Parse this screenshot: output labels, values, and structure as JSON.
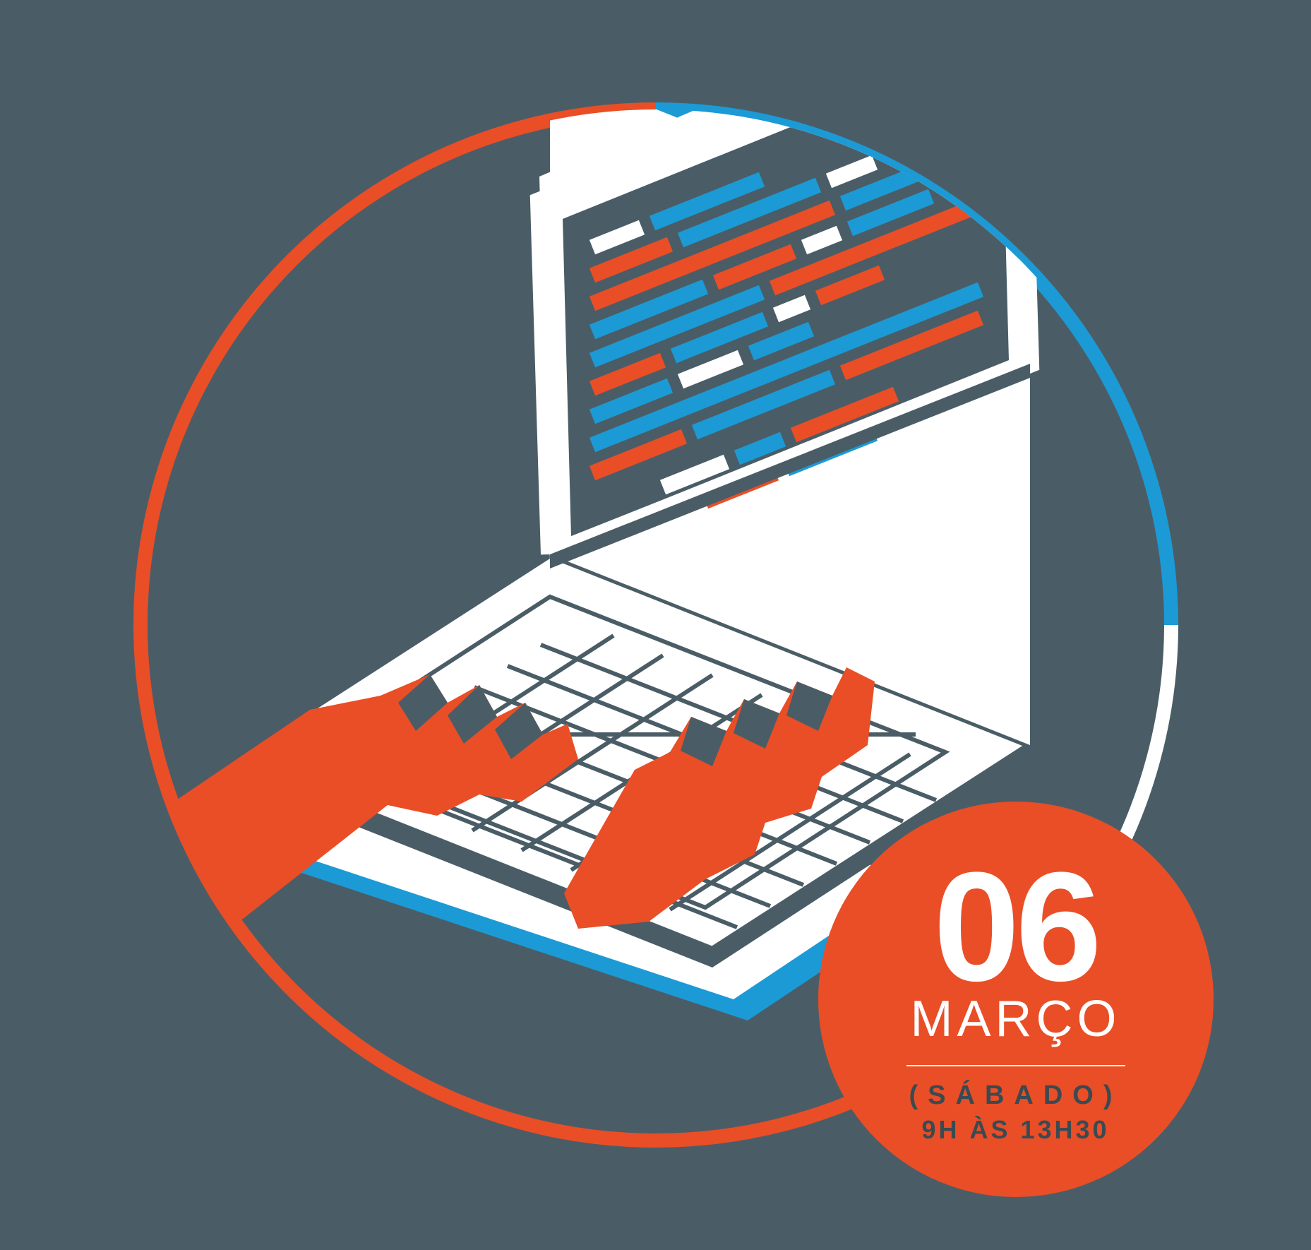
{
  "colors": {
    "background": "#4a5d66",
    "orange": "#e94e27",
    "blue": "#1c9ad6",
    "white": "#ffffff",
    "dark": "#3a4a52"
  },
  "event": {
    "day": "06",
    "month": "MARÇO",
    "weekday": "(SÁBADO)",
    "hours": "9H ÀS 13H30"
  },
  "illustration": {
    "description": "hands-typing-on-laptop-with-code-on-screen",
    "ring_segments": [
      "orange",
      "blue",
      "white",
      "orange"
    ]
  }
}
